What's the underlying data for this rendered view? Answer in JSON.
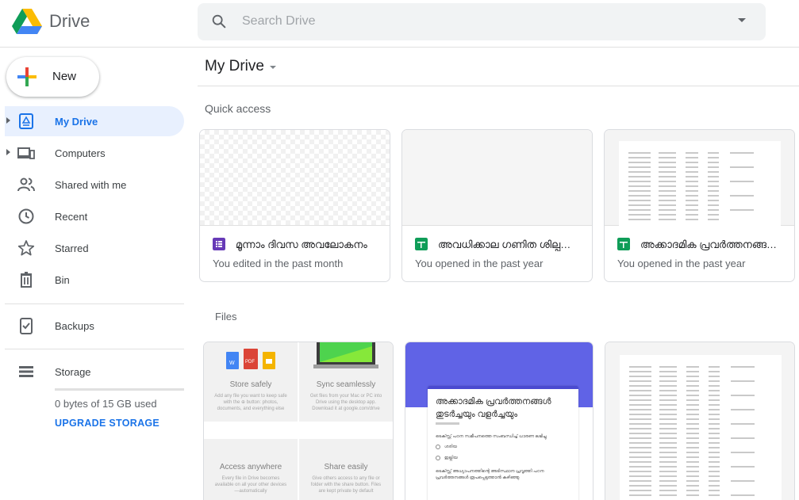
{
  "header": {
    "brand": "Drive",
    "search_placeholder": "Search Drive"
  },
  "sidebar": {
    "new_label": "New",
    "items": [
      {
        "label": "My Drive",
        "icon": "my-drive-icon",
        "active": true,
        "expandable": true
      },
      {
        "label": "Computers",
        "icon": "computers-icon",
        "active": false,
        "expandable": true
      },
      {
        "label": "Shared with me",
        "icon": "shared-with-me-icon",
        "active": false
      },
      {
        "label": "Recent",
        "icon": "clock-icon",
        "active": false
      },
      {
        "label": "Starred",
        "icon": "star-icon",
        "active": false
      },
      {
        "label": "Bin",
        "icon": "trash-icon",
        "active": false
      },
      {
        "label": "Backups",
        "icon": "backups-icon",
        "active": false
      },
      {
        "label": "Storage",
        "icon": "storage-icon",
        "active": false
      }
    ],
    "storage_usage": "0 bytes of 15 GB used",
    "upgrade_label": "UPGRADE STORAGE"
  },
  "main": {
    "title": "My Drive",
    "quick_access_label": "Quick access",
    "quick_access": [
      {
        "name": "മൂന്നാം ദിവസ അവലോകനം",
        "subtitle": "You edited in the past month",
        "type": "form",
        "type_color": "#673ab7"
      },
      {
        "name": "അവധിക്കാല ഗണിത ശില്പശാല (R...",
        "subtitle": "You opened in the past year",
        "type": "sheet",
        "type_color": "#0f9d58"
      },
      {
        "name": "അക്കാദമിക പ്രവർത്തനങ്ങൾ ഇടർ...",
        "subtitle": "You opened in the past year",
        "type": "sheet",
        "type_color": "#0f9d58"
      }
    ],
    "files_label": "Files",
    "files": {
      "welcome_tiles": [
        {
          "title": "Store safely",
          "text": "Add any file you want to keep safe with the ⊕ button: photos, documents, and everything else"
        },
        {
          "title": "Sync seamlessly",
          "text": "Get files from your Mac or PC into Drive using the desktop app. Download it at google.com/drive"
        },
        {
          "title": "Access anywhere",
          "text": "Every file in Drive becomes available on all your other devices—automatically"
        },
        {
          "title": "Share easily",
          "text": "Give others access to any file or folder with the share button. Files are kept private by default"
        }
      ],
      "form_preview": {
        "title": "അക്കാദമിക പ്രവർത്തനങ്ങൾ തുടർച്ചയും വളർച്ചയും",
        "question1": "ടെക്സ്റ്റ് പഠന സമീപനത്തെ സംബന്ധിച്ച് ധാരണ ലഭിച്ചു",
        "options": [
          "ശരിയ",
          "ഇല്ലിയ"
        ],
        "question2": "ടെക്സ്റ്റ് അധ്യാപനത്തിന്റെ അടിസ്ഥാന പ്രവൃത്തി പഠന പ്രവർത്തനങ്ങൾ രൂപപ്പെടുത്താൻ കഴിഞ്ഞു"
      }
    }
  },
  "colors": {
    "accent": "#1a73e8",
    "active_bg": "#e8f0fe",
    "form_purple": "#6063e6",
    "welcome_tile_bg": "#f1f1f1"
  }
}
